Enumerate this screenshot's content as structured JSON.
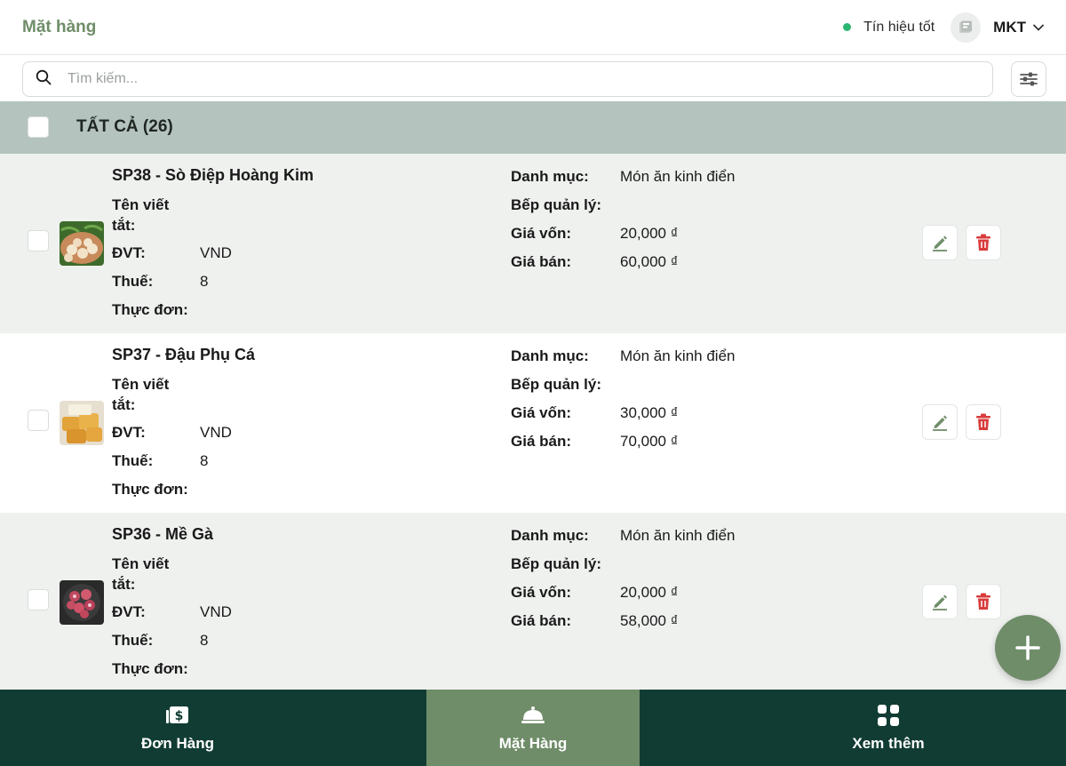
{
  "header": {
    "title": "Mặt hàng",
    "signal_text": "Tín hiệu tốt",
    "username": "MKT"
  },
  "search": {
    "placeholder": "Tìm kiếm..."
  },
  "all_bar": {
    "label": "TẤT CẢ (26)"
  },
  "labels": {
    "short_name": "Tên viết\ntắt:",
    "unit": "ĐVT:",
    "tax": "Thuế:",
    "menu": "Thực đơn:",
    "category": "Danh mục:",
    "kitchen": "Bếp quản lý:",
    "cost": "Giá vốn:",
    "price": "Giá bán:"
  },
  "items": [
    {
      "title": "SP38 - Sò Điệp Hoàng Kim",
      "short_name": "",
      "unit": "VND",
      "tax": "8",
      "menu": "",
      "category": "Món ăn kinh điển",
      "kitchen": "",
      "cost": "20,000 ₫",
      "price": "60,000 ₫",
      "thumb_icon": "scallop-image"
    },
    {
      "title": "SP37 - Đậu Phụ Cá",
      "short_name": "",
      "unit": "VND",
      "tax": "8",
      "menu": "",
      "category": "Món ăn kinh điển",
      "kitchen": "",
      "cost": "30,000 ₫",
      "price": "70,000 ₫",
      "thumb_icon": "fish-tofu-image"
    },
    {
      "title": "SP36 - Mề Gà",
      "short_name": "",
      "unit": "VND",
      "tax": "8",
      "menu": "",
      "category": "Món ăn kinh điển",
      "kitchen": "",
      "cost": "20,000 ₫",
      "price": "58,000 ₫",
      "thumb_icon": "chicken-gizzard-image"
    }
  ],
  "nav": {
    "orders": "Đơn Hàng",
    "items": "Mặt Hàng",
    "more": "Xem thêm"
  },
  "colors": {
    "accent": "#6f8d69",
    "nav_bg": "#113c33",
    "all_bar_bg": "#b4c3be",
    "delete_red": "#d93b3b",
    "signal_green": "#2bb673"
  }
}
